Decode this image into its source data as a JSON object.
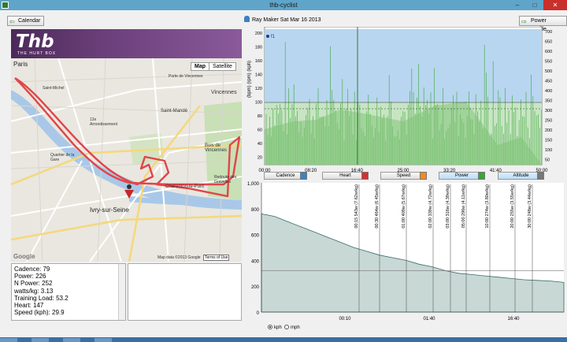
{
  "window": {
    "title": "thb-cyclist",
    "min": "–",
    "max": "□",
    "close": "✕"
  },
  "toolbar": {
    "calendar_label": "Calendar",
    "ride_label": "Ray Maker Sat Mar 16 2013",
    "power_profile_label": "Power Profile"
  },
  "logo": {
    "text": "Thb",
    "subtitle": "THE HURT BOX"
  },
  "map": {
    "tabs": [
      "Map",
      "Satellite"
    ],
    "labels": [
      "Paris",
      "Vincennes",
      "Saint-Mandé",
      "Bois de Vincennes",
      "Ivry-sur-Seine",
      "Charenton-le-Pont",
      "Quartier de la Gare",
      "Redoute des Gravelles",
      "12e Arrondissement",
      "Porte de Vincennes",
      "Saint-Michel"
    ],
    "attribution": "Map data ©2013 Google",
    "terms": "Terms of Use",
    "google": "Google"
  },
  "stats": {
    "lines": [
      "Cadence: 79",
      "Power: 226",
      "N Power: 252",
      "watts/kg: 3.13",
      "Training Load: 53.2",
      "Heart: 147",
      "Speed (kph): 29.9"
    ]
  },
  "top_chart": {
    "left_axis_label": "(bpm) (rpm) (kph)",
    "left_ticks": [
      "200",
      "180",
      "160",
      "140",
      "120",
      "100",
      "80",
      "60",
      "40",
      "20"
    ],
    "right_ticks": [
      "700",
      "650",
      "600",
      "550",
      "500",
      "450",
      "400",
      "350",
      "300",
      "250",
      "200",
      "150",
      "100",
      "50"
    ],
    "x_ticks": [
      "00:00",
      "08:20",
      "16:40",
      "25:00",
      "33:20",
      "41:40",
      "50:00"
    ],
    "marker_label": "f1"
  },
  "series_buttons": [
    {
      "label": "Cadence",
      "color": "#3b83c0",
      "on": false
    },
    {
      "label": "Heart",
      "color": "#d32f2f",
      "on": false
    },
    {
      "label": "Speed",
      "color": "#f08a1c",
      "on": false
    },
    {
      "label": "Power",
      "color": "#3aa535",
      "on": true
    },
    {
      "label": "Altitude",
      "color": "#777777",
      "on": true
    }
  ],
  "chart_data": {
    "type": "line",
    "title": "",
    "xlabel": "",
    "ylabel": "",
    "y_ticks": [
      "1,000",
      "800",
      "600",
      "400",
      "200",
      "0"
    ],
    "x_ticks": [
      "00:10",
      "01:40",
      "16:40"
    ],
    "ylim": [
      0,
      1000
    ],
    "series": [
      {
        "values": [
          760,
          740,
          700,
          660,
          620,
          580,
          540,
          500,
          470,
          440,
          420,
          400,
          370,
          350,
          320,
          300,
          290,
          280,
          270,
          260,
          250,
          245,
          240,
          230
        ]
      }
    ],
    "reference_line": 320,
    "annotations": [
      "00:15 543w (7.62w/kg)",
      "00:30 464w (6.45w/kg)",
      "01:00 409w (5.67w/kg)",
      "02:00 339w (4.72w/kg)",
      "03:00 316w (4.39w/kg)",
      "05:00 296w (4.11w/kg)",
      "10:00 274w (3.80w/kg)",
      "20:00 255w (3.55w/kg)",
      "30:00 248w (3.44w/kg)"
    ]
  },
  "units": {
    "kph": "kph",
    "mph": "mph",
    "selected": "kph"
  }
}
